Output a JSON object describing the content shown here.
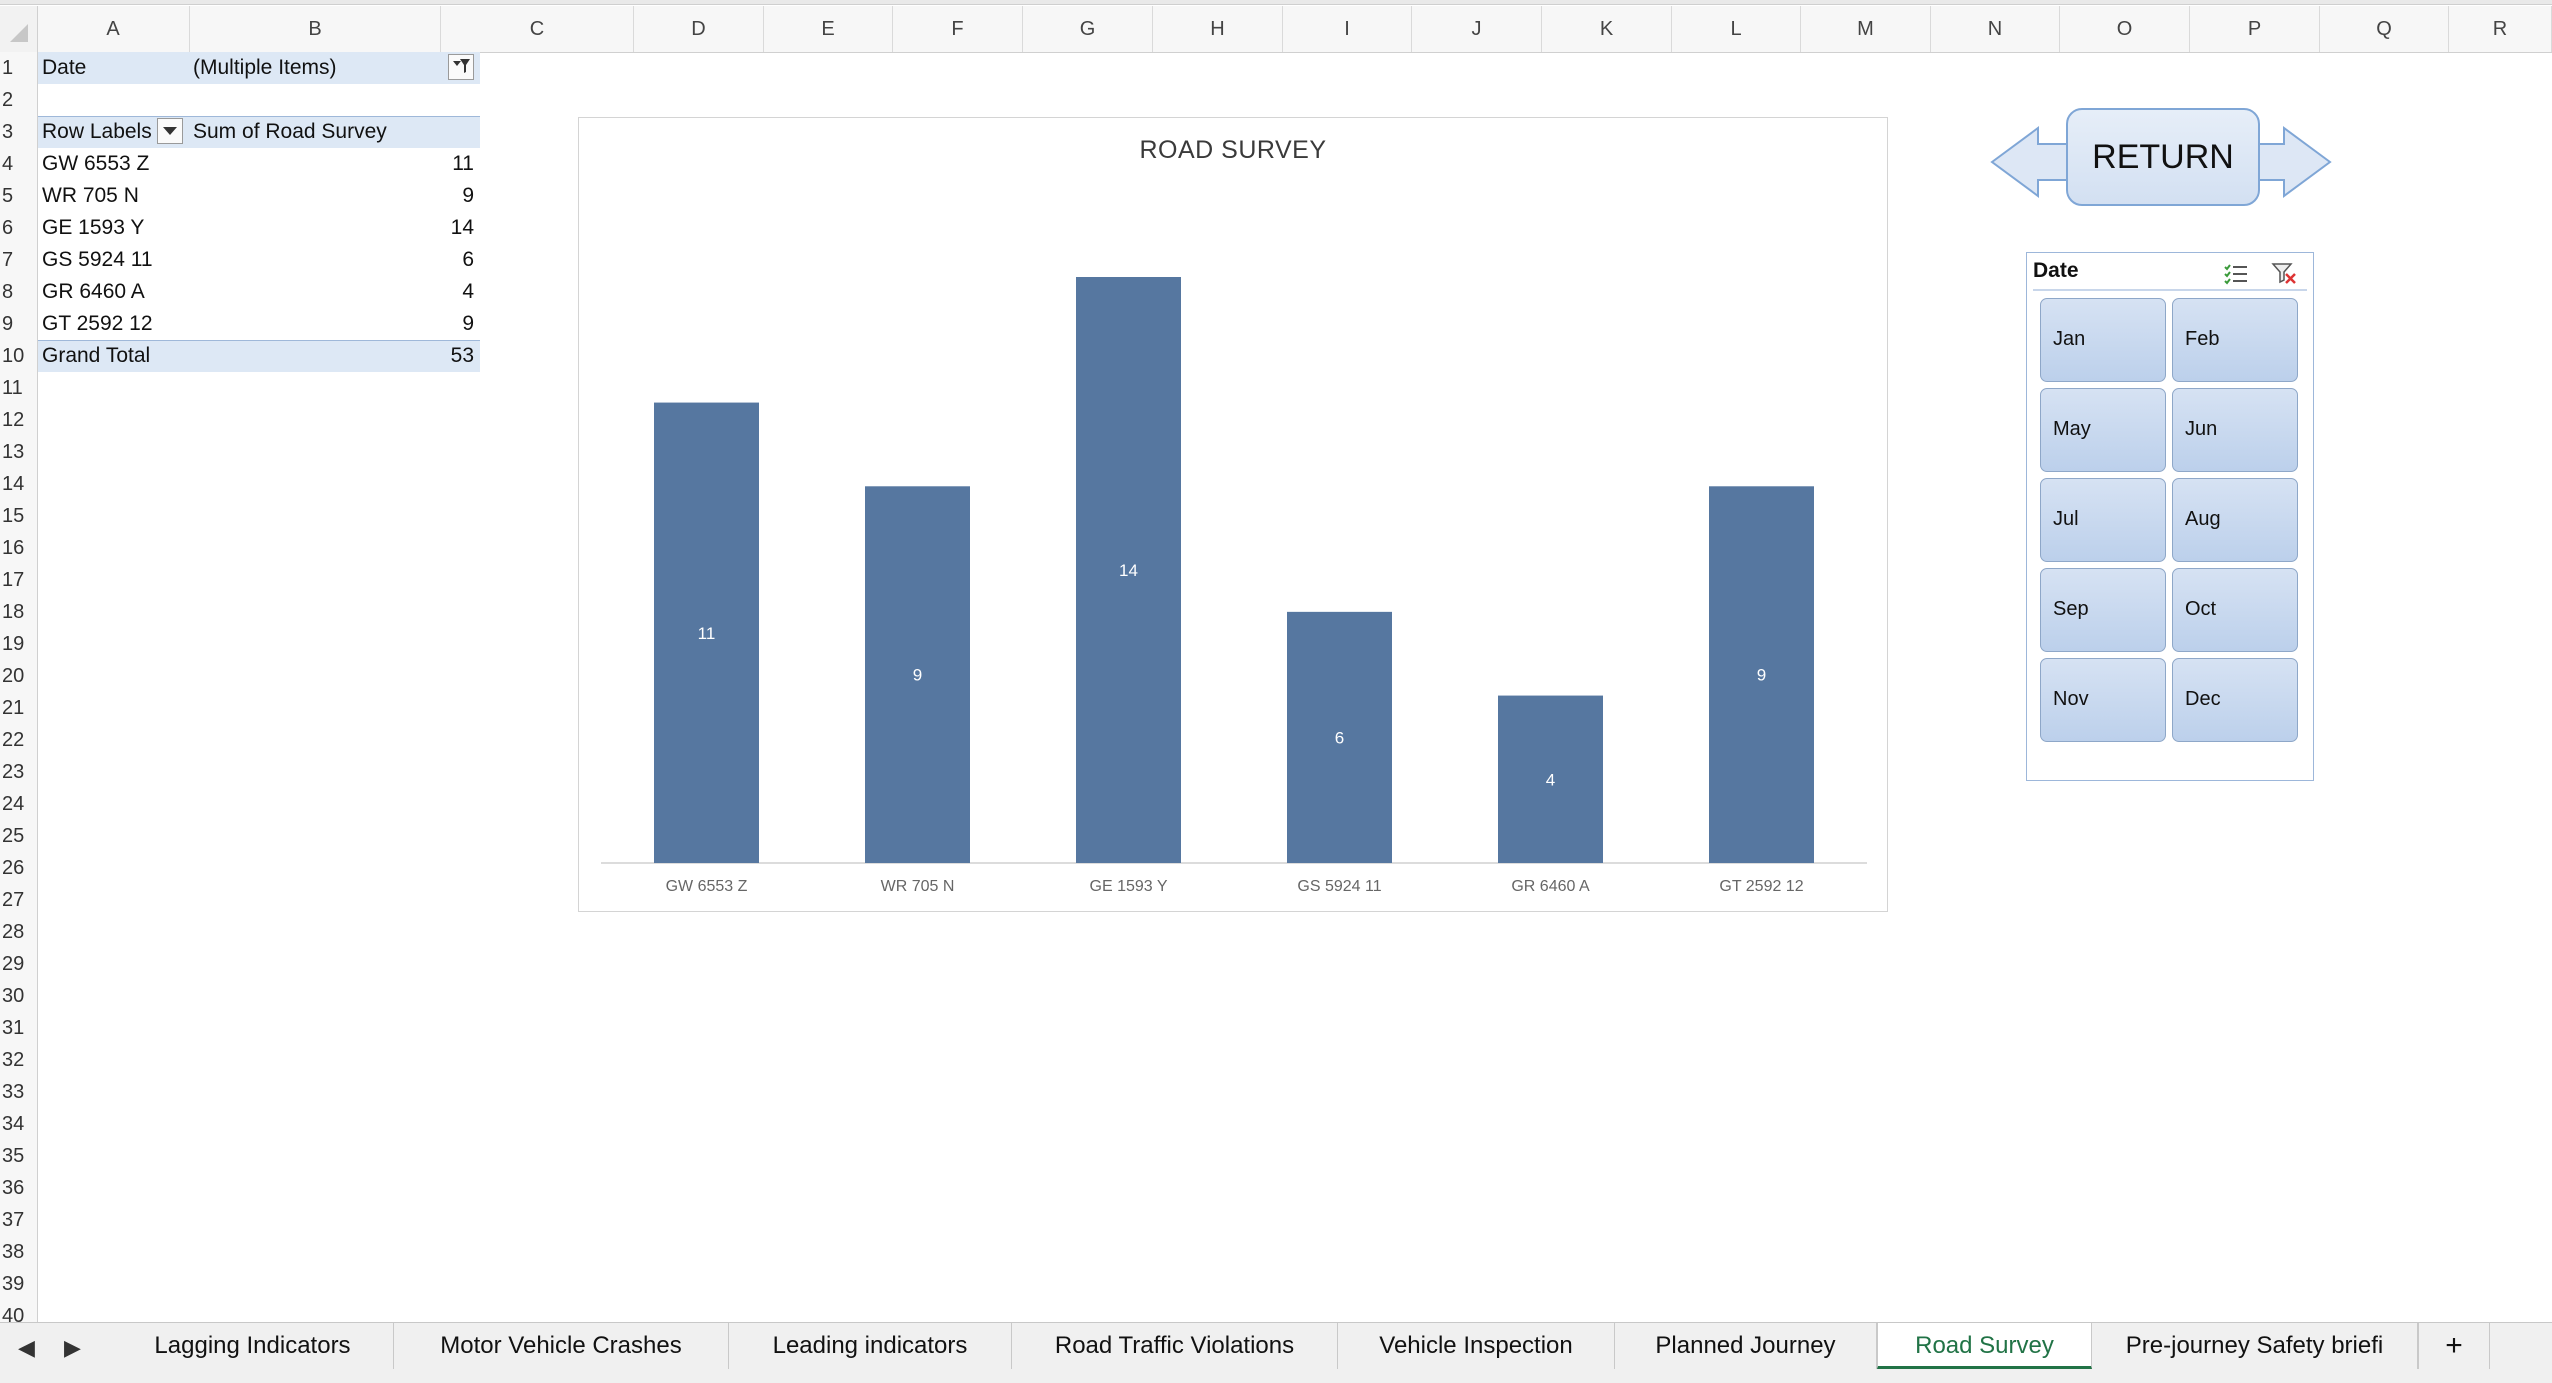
{
  "columns": [
    "A",
    "B",
    "C",
    "D",
    "E",
    "F",
    "G",
    "H",
    "I",
    "J",
    "K",
    "L",
    "M",
    "N",
    "O",
    "P",
    "Q",
    "R"
  ],
  "rows": [
    "1",
    "2",
    "3",
    "4",
    "5",
    "6",
    "7",
    "8",
    "9",
    "10",
    "11",
    "12",
    "13",
    "14",
    "15",
    "16",
    "17",
    "18",
    "19",
    "20",
    "21",
    "22",
    "23",
    "24",
    "25",
    "26",
    "27",
    "28",
    "29",
    "30",
    "31",
    "32",
    "33",
    "34",
    "35",
    "36",
    "37",
    "38",
    "39",
    "40"
  ],
  "pivot": {
    "filter_label": "Date",
    "filter_value": "(Multiple Items)",
    "row_labels_header": "Row Labels",
    "sum_header": "Sum of Road Survey",
    "items": [
      {
        "label": "GW 6553 Z",
        "value": "11"
      },
      {
        "label": "WR 705 N",
        "value": "9"
      },
      {
        "label": "GE 1593 Y",
        "value": "14"
      },
      {
        "label": "GS 5924 11",
        "value": "6"
      },
      {
        "label": "GR 6460 A",
        "value": "4"
      },
      {
        "label": "GT 2592 12",
        "value": "9"
      }
    ],
    "grand_total_label": "Grand Total",
    "grand_total_value": "53"
  },
  "chart_data": {
    "type": "bar",
    "title": "ROAD SURVEY",
    "categories": [
      "GW 6553 Z",
      "WR 705 N",
      "GE 1593 Y",
      "GS 5924 11",
      "GR 6460 A",
      "GT 2592 12"
    ],
    "values": [
      11,
      9,
      14,
      6,
      4,
      9
    ],
    "xlabel": "",
    "ylabel": "",
    "ylim": [
      0,
      15
    ],
    "grid": false,
    "legend": "none",
    "bar_color": "#5677a0",
    "data_labels": true
  },
  "return_button": {
    "label": "RETURN"
  },
  "slicer": {
    "title": "Date",
    "months": [
      "Jan",
      "Feb",
      "May",
      "Jun",
      "Jul",
      "Aug",
      "Sep",
      "Oct",
      "Nov",
      "Dec"
    ]
  },
  "sheet_tabs": [
    {
      "label": "Lagging Indicators",
      "active": false
    },
    {
      "label": "Motor Vehicle Crashes",
      "active": false
    },
    {
      "label": "Leading indicators",
      "active": false
    },
    {
      "label": "Road Traffic Violations",
      "active": false
    },
    {
      "label": "Vehicle Inspection",
      "active": false
    },
    {
      "label": "Planned Journey",
      "active": false
    },
    {
      "label": "Road Survey",
      "active": true
    },
    {
      "label": "Pre-journey Safety briefi",
      "active": false
    }
  ],
  "tab_controls": {
    "prev": "◀",
    "next": "▶",
    "add": "+"
  },
  "colors": {
    "accent_green": "#217346",
    "pivot_highlight": "#dde8f5",
    "slicer_button": "#c8d8ee"
  }
}
